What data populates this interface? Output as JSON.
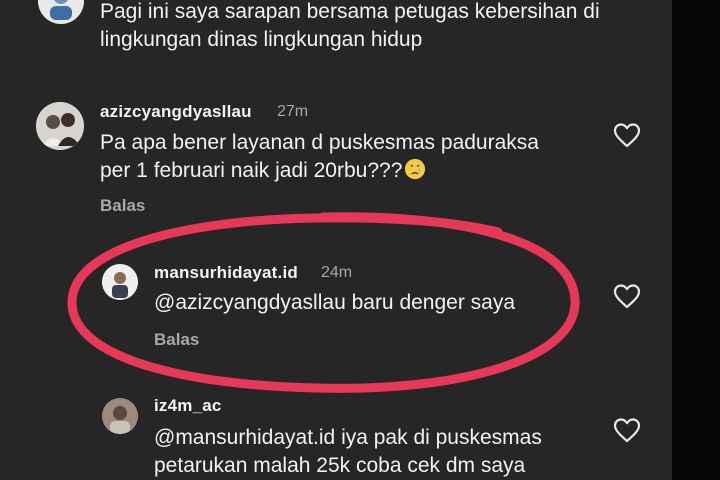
{
  "comments": [
    {
      "text_lines": [
        "Pagi ini saya sarapan bersama petugas kebersihan di",
        "lingkungan dinas lingkungan hidup"
      ]
    },
    {
      "username": "azizcyangdyasllau",
      "time": "27m",
      "text_lines": [
        "Pa apa bener layanan d puskesmas paduraksa",
        "per 1 februari naik jadi 20rbu???"
      ],
      "emoji": "crying-face-icon",
      "reply_label": "Balas"
    },
    {
      "username": "mansurhidayat.id",
      "time": "24m",
      "text_lines": [
        "@azizcyangdyasllau  baru denger saya"
      ],
      "reply_label": "Balas"
    },
    {
      "username": "iz4m_ac",
      "text_lines": [
        "@mansurhidayat.id iya pak di puskesmas",
        "petarukan malah 25k coba cek dm saya"
      ]
    }
  ],
  "annotation": {
    "color": "#e8385a"
  },
  "colors": {
    "background": "#262626",
    "text": "#f2f2f2",
    "secondary_text": "#a8a8a8"
  }
}
